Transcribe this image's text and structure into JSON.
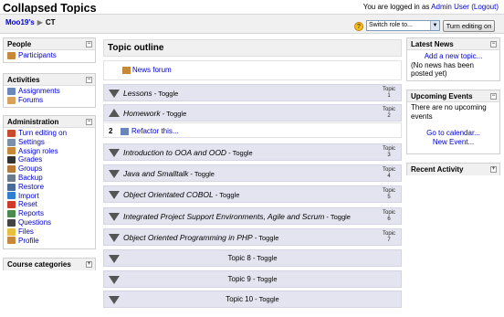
{
  "header": {
    "site_title": "Collapsed Topics",
    "login_prefix": "You are logged in as",
    "user_name": "Admin User",
    "logout_label": "(Logout)"
  },
  "navbar": {
    "course_link": "Moo19's",
    "separator": "▶",
    "current": "CT",
    "role_select": "Switch role to...",
    "edit_button": "Turn editing on"
  },
  "left": {
    "people": {
      "title": "People",
      "items": [
        {
          "label": "Participants",
          "icon": "participants-icon",
          "color": "#c8883a"
        }
      ]
    },
    "activities": {
      "title": "Activities",
      "items": [
        {
          "label": "Assignments",
          "icon": "assignment-icon",
          "color": "#6b86b8"
        },
        {
          "label": "Forums",
          "icon": "forum-icon",
          "color": "#d9a25a"
        }
      ]
    },
    "administration": {
      "title": "Administration",
      "items": [
        {
          "label": "Turn editing on",
          "icon": "edit-icon",
          "color": "#c94a2c"
        },
        {
          "label": "Settings",
          "icon": "settings-icon",
          "color": "#7a8fa8"
        },
        {
          "label": "Assign roles",
          "icon": "roles-icon",
          "color": "#c8883a"
        },
        {
          "label": "Grades",
          "icon": "grades-icon",
          "color": "#333333"
        },
        {
          "label": "Groups",
          "icon": "groups-icon",
          "color": "#b87a3a"
        },
        {
          "label": "Backup",
          "icon": "backup-icon",
          "color": "#6a7a8a"
        },
        {
          "label": "Restore",
          "icon": "restore-icon",
          "color": "#4a6a9a"
        },
        {
          "label": "Import",
          "icon": "import-icon",
          "color": "#2f7fd0"
        },
        {
          "label": "Reset",
          "icon": "reset-icon",
          "color": "#d03a2a"
        },
        {
          "label": "Reports",
          "icon": "reports-icon",
          "color": "#4a8a4a"
        },
        {
          "label": "Questions",
          "icon": "questions-icon",
          "color": "#444444"
        },
        {
          "label": "Files",
          "icon": "files-icon",
          "color": "#e8c040"
        },
        {
          "label": "Profile",
          "icon": "profile-icon",
          "color": "#c8883a"
        }
      ]
    },
    "categories": {
      "title": "Course categories"
    }
  },
  "main": {
    "heading": "Topic outline",
    "news_forum": "News forum",
    "topics": [
      {
        "title": "Lessons",
        "toggle": " - Toggle",
        "label": "Topic",
        "num": "1",
        "open": false
      },
      {
        "title": "Homework",
        "toggle": " - Toggle",
        "label": "Topic",
        "num": "2",
        "open": true
      },
      {
        "title": "Introduction to OOA and OOD",
        "toggle": " - Toggle",
        "label": "Topic",
        "num": "3",
        "open": false
      },
      {
        "title": "Java and Smalltalk",
        "toggle": " - Toggle",
        "label": "Topic",
        "num": "4",
        "open": false
      },
      {
        "title": "Object Orientated COBOL",
        "toggle": " - Toggle",
        "label": "Topic",
        "num": "5",
        "open": false
      },
      {
        "title": "Integrated Project Support Environments, Agile and Scrum",
        "toggle": " - Toggle",
        "label": "Topic",
        "num": "6",
        "open": false
      },
      {
        "title": "Object Oriented Programming in PHP",
        "toggle": " - Toggle",
        "label": "Topic",
        "num": "7",
        "open": false
      },
      {
        "title": "Topic 8",
        "toggle": " - Toggle"
      },
      {
        "title": "Topic 9",
        "toggle": " - Toggle"
      },
      {
        "title": "Topic 10",
        "toggle": " - Toggle"
      }
    ],
    "open_section": {
      "number": "2",
      "activity": "Refactor this..."
    }
  },
  "right": {
    "news": {
      "title": "Latest News",
      "add_link": "Add a new topic...",
      "empty": "(No news has been posted yet)"
    },
    "events": {
      "title": "Upcoming Events",
      "empty": "There are no upcoming events",
      "calendar_link": "Go to calendar...",
      "new_event": "New Event..."
    },
    "activity": {
      "title": "Recent Activity"
    }
  },
  "colors": {
    "link": "#0000cc",
    "section_gray": "#e4e4f0",
    "header_gray": "#f0f0f0"
  }
}
